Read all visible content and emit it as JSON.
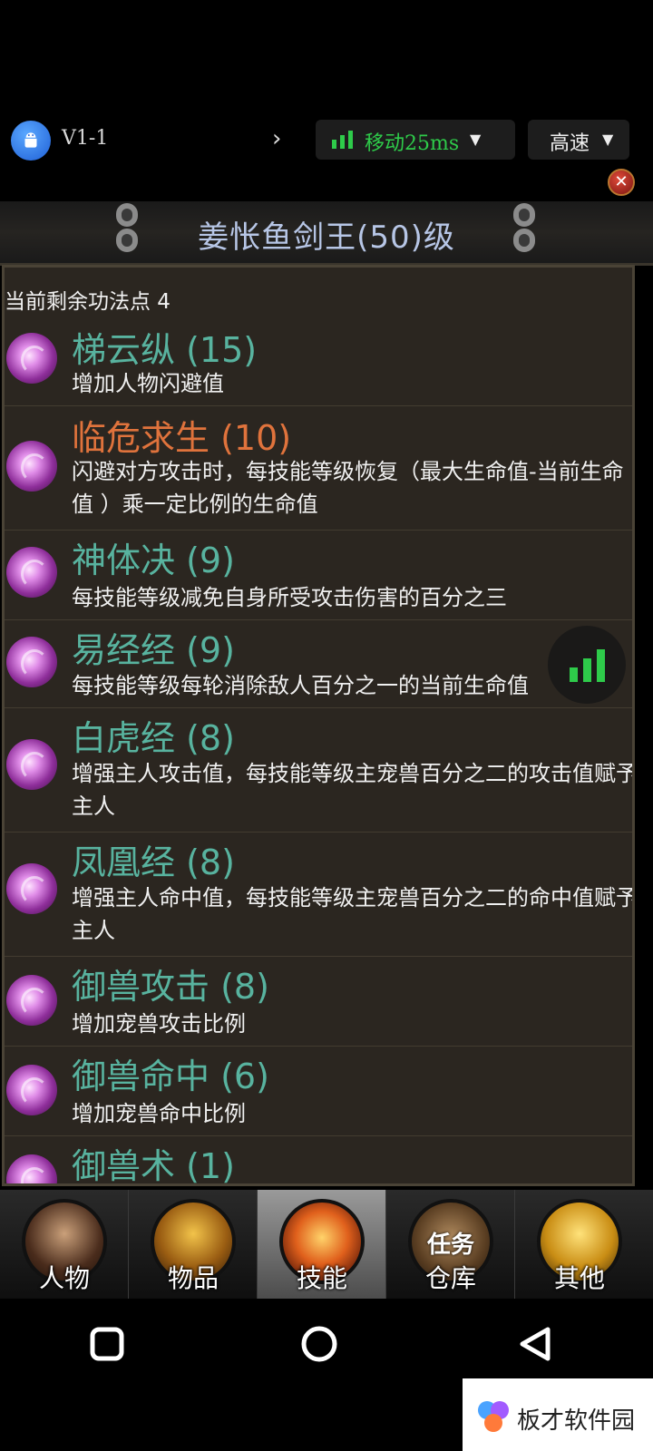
{
  "top_bar": {
    "version": "V1-1",
    "network_label": "移动25ms",
    "speed_label": "高速"
  },
  "title": "姜怅鱼剑王(50)级",
  "points_text": "当前剩余功法点 4",
  "skills": [
    {
      "name": "梯云纵 (15)",
      "desc": "增加人物闪避值"
    },
    {
      "name": "临危求生 (10)",
      "desc": "闪避对方攻击时，每技能等级恢复（最大生命值-当前生命值 ）乘一定比例的生命值"
    },
    {
      "name": "神体决 (9)",
      "desc": "每技能等级减免自身所受攻击伤害的百分之三"
    },
    {
      "name": "易经经 (9)",
      "desc": "每技能等级每轮消除敌人百分之一的当前生命值"
    },
    {
      "name": "白虎经 (8)",
      "desc": "增强主人攻击值，每技能等级主宠兽百分之二的攻击值赋予主人"
    },
    {
      "name": "凤凰经 (8)",
      "desc": "增强主人命中值，每技能等级主宠兽百分之二的命中值赋予主人"
    },
    {
      "name": "御兽攻击 (8)",
      "desc": "增加宠兽攻击比例"
    },
    {
      "name": "御兽命中 (6)",
      "desc": "增加宠兽命中比例"
    },
    {
      "name": "御兽术 (1)",
      "desc": ""
    }
  ],
  "tabs": [
    {
      "label": "人物",
      "overlay": ""
    },
    {
      "label": "物品",
      "overlay": ""
    },
    {
      "label": "技能",
      "overlay": ""
    },
    {
      "label": "仓库",
      "overlay": "任务"
    },
    {
      "label": "其他",
      "overlay": ""
    }
  ],
  "active_tab": "技能",
  "watermark": "板才软件园",
  "colors": {
    "skill_name": "#58b39f",
    "skill_name_highlight": "#e0733c",
    "network_green": "#2ecb4a",
    "title_blue": "#b7c6e6"
  }
}
